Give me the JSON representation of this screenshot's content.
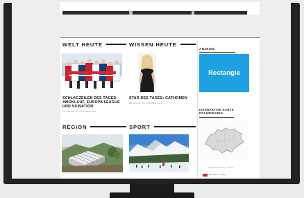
{
  "sections": {
    "welt_heute": "WELT HEUTE",
    "wissen_heute": "WISSEN HEUTE",
    "region": "REGION",
    "sport": "SPORT"
  },
  "articles": [
    {
      "headline": "SCHLAGZEILEN DES TAGES: AMOKLAUF, EUROPA LEAGUE UND SKINATION",
      "meta": "28. OKTOB. / 26. OKTOBER 2016"
    },
    {
      "headline": "STAR DES TAGES: CATHOMEN",
      "meta": "AM HEUTE / 26. OKTOBER 2016"
    }
  ],
  "sidebar": {
    "ad_label": "ANZEIGE",
    "ad_text": "Rectangle",
    "map_title": "INTERAKTIVE KARTE POLIZEIRADIO",
    "map_credit": "ost.ch/polizeiradio-bsp... KartVR",
    "srf_text": "SRF Sport · mit app"
  },
  "colors": {
    "ad_background": "#1da1e2",
    "srf_red": "#c9252c"
  }
}
